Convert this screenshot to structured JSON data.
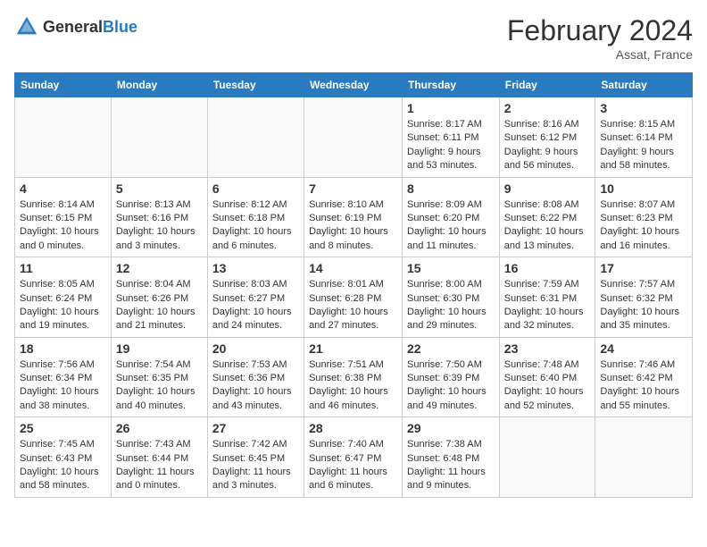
{
  "header": {
    "logo_general": "General",
    "logo_blue": "Blue",
    "title": "February 2024",
    "subtitle": "Assat, France"
  },
  "days_of_week": [
    "Sunday",
    "Monday",
    "Tuesday",
    "Wednesday",
    "Thursday",
    "Friday",
    "Saturday"
  ],
  "weeks": [
    [
      {
        "day": "",
        "info": ""
      },
      {
        "day": "",
        "info": ""
      },
      {
        "day": "",
        "info": ""
      },
      {
        "day": "",
        "info": ""
      },
      {
        "day": "1",
        "info": "Sunrise: 8:17 AM\nSunset: 6:11 PM\nDaylight: 9 hours\nand 53 minutes."
      },
      {
        "day": "2",
        "info": "Sunrise: 8:16 AM\nSunset: 6:12 PM\nDaylight: 9 hours\nand 56 minutes."
      },
      {
        "day": "3",
        "info": "Sunrise: 8:15 AM\nSunset: 6:14 PM\nDaylight: 9 hours\nand 58 minutes."
      }
    ],
    [
      {
        "day": "4",
        "info": "Sunrise: 8:14 AM\nSunset: 6:15 PM\nDaylight: 10 hours\nand 0 minutes."
      },
      {
        "day": "5",
        "info": "Sunrise: 8:13 AM\nSunset: 6:16 PM\nDaylight: 10 hours\nand 3 minutes."
      },
      {
        "day": "6",
        "info": "Sunrise: 8:12 AM\nSunset: 6:18 PM\nDaylight: 10 hours\nand 6 minutes."
      },
      {
        "day": "7",
        "info": "Sunrise: 8:10 AM\nSunset: 6:19 PM\nDaylight: 10 hours\nand 8 minutes."
      },
      {
        "day": "8",
        "info": "Sunrise: 8:09 AM\nSunset: 6:20 PM\nDaylight: 10 hours\nand 11 minutes."
      },
      {
        "day": "9",
        "info": "Sunrise: 8:08 AM\nSunset: 6:22 PM\nDaylight: 10 hours\nand 13 minutes."
      },
      {
        "day": "10",
        "info": "Sunrise: 8:07 AM\nSunset: 6:23 PM\nDaylight: 10 hours\nand 16 minutes."
      }
    ],
    [
      {
        "day": "11",
        "info": "Sunrise: 8:05 AM\nSunset: 6:24 PM\nDaylight: 10 hours\nand 19 minutes."
      },
      {
        "day": "12",
        "info": "Sunrise: 8:04 AM\nSunset: 6:26 PM\nDaylight: 10 hours\nand 21 minutes."
      },
      {
        "day": "13",
        "info": "Sunrise: 8:03 AM\nSunset: 6:27 PM\nDaylight: 10 hours\nand 24 minutes."
      },
      {
        "day": "14",
        "info": "Sunrise: 8:01 AM\nSunset: 6:28 PM\nDaylight: 10 hours\nand 27 minutes."
      },
      {
        "day": "15",
        "info": "Sunrise: 8:00 AM\nSunset: 6:30 PM\nDaylight: 10 hours\nand 29 minutes."
      },
      {
        "day": "16",
        "info": "Sunrise: 7:59 AM\nSunset: 6:31 PM\nDaylight: 10 hours\nand 32 minutes."
      },
      {
        "day": "17",
        "info": "Sunrise: 7:57 AM\nSunset: 6:32 PM\nDaylight: 10 hours\nand 35 minutes."
      }
    ],
    [
      {
        "day": "18",
        "info": "Sunrise: 7:56 AM\nSunset: 6:34 PM\nDaylight: 10 hours\nand 38 minutes."
      },
      {
        "day": "19",
        "info": "Sunrise: 7:54 AM\nSunset: 6:35 PM\nDaylight: 10 hours\nand 40 minutes."
      },
      {
        "day": "20",
        "info": "Sunrise: 7:53 AM\nSunset: 6:36 PM\nDaylight: 10 hours\nand 43 minutes."
      },
      {
        "day": "21",
        "info": "Sunrise: 7:51 AM\nSunset: 6:38 PM\nDaylight: 10 hours\nand 46 minutes."
      },
      {
        "day": "22",
        "info": "Sunrise: 7:50 AM\nSunset: 6:39 PM\nDaylight: 10 hours\nand 49 minutes."
      },
      {
        "day": "23",
        "info": "Sunrise: 7:48 AM\nSunset: 6:40 PM\nDaylight: 10 hours\nand 52 minutes."
      },
      {
        "day": "24",
        "info": "Sunrise: 7:46 AM\nSunset: 6:42 PM\nDaylight: 10 hours\nand 55 minutes."
      }
    ],
    [
      {
        "day": "25",
        "info": "Sunrise: 7:45 AM\nSunset: 6:43 PM\nDaylight: 10 hours\nand 58 minutes."
      },
      {
        "day": "26",
        "info": "Sunrise: 7:43 AM\nSunset: 6:44 PM\nDaylight: 11 hours\nand 0 minutes."
      },
      {
        "day": "27",
        "info": "Sunrise: 7:42 AM\nSunset: 6:45 PM\nDaylight: 11 hours\nand 3 minutes."
      },
      {
        "day": "28",
        "info": "Sunrise: 7:40 AM\nSunset: 6:47 PM\nDaylight: 11 hours\nand 6 minutes."
      },
      {
        "day": "29",
        "info": "Sunrise: 7:38 AM\nSunset: 6:48 PM\nDaylight: 11 hours\nand 9 minutes."
      },
      {
        "day": "",
        "info": ""
      },
      {
        "day": "",
        "info": ""
      }
    ]
  ]
}
